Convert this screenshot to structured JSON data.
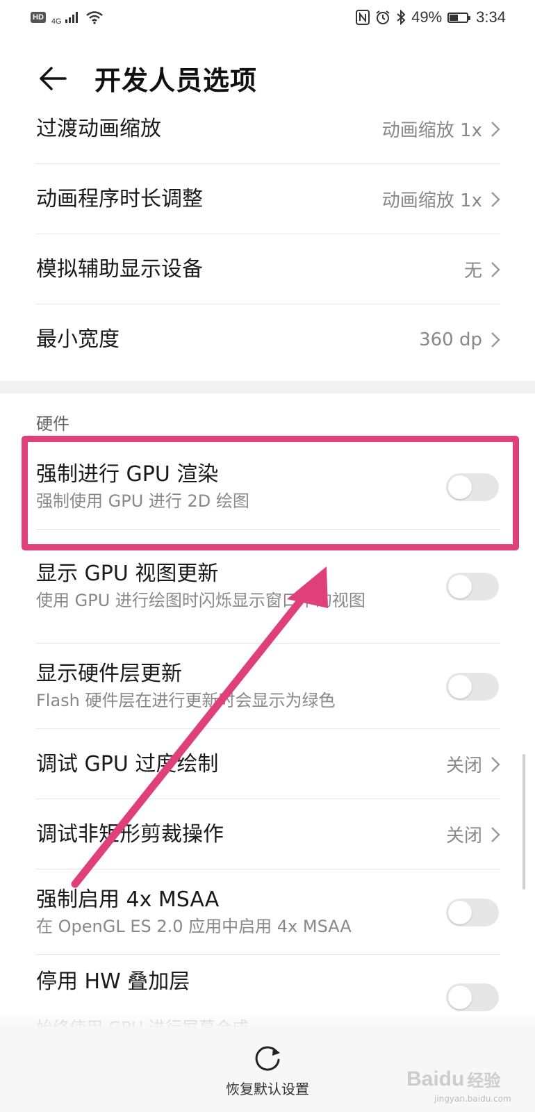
{
  "status_bar": {
    "hd": "HD",
    "network": "4G",
    "battery": "49%",
    "battery_level": 0.49,
    "time": "3:34",
    "icons": [
      "signal-icon",
      "wifi-icon",
      "nfc-icon",
      "alarm-icon",
      "bluetooth-icon",
      "battery-icon"
    ]
  },
  "header": {
    "title": "开发人员选项",
    "back_icon": "back-arrow-icon"
  },
  "items_top": [
    {
      "title": "过渡动画缩放",
      "value": "动画缩放 1x"
    },
    {
      "title": "动画程序时长调整",
      "value": "动画缩放 1x"
    },
    {
      "title": "模拟辅助显示设备",
      "value": "无"
    },
    {
      "title": "最小宽度",
      "value": "360 dp"
    }
  ],
  "hardware": {
    "section_label": "硬件",
    "items": [
      {
        "title": "强制进行 GPU 渲染",
        "subtitle": "强制使用 GPU 进行 2D 绘图",
        "toggle": false
      },
      {
        "title": "显示 GPU 视图更新",
        "subtitle": "使用 GPU 进行绘图时闪烁显示窗口中的视图",
        "toggle": false
      },
      {
        "title": "显示硬件层更新",
        "subtitle": "Flash 硬件层在进行更新时会显示为绿色",
        "toggle": false
      },
      {
        "title": "调试 GPU 过度绘制",
        "value": "关闭"
      },
      {
        "title": "调试非矩形剪裁操作",
        "value": "关闭"
      },
      {
        "title": "强制启用 4x MSAA",
        "subtitle": "在 OpenGL ES 2.0 应用中启用 4x MSAA",
        "toggle": false
      },
      {
        "title": "停用 HW 叠加层",
        "subtitle": "始终使用 GPU 进行屏幕合成",
        "toggle": false
      }
    ]
  },
  "bottom": {
    "restore_label": "恢复默认设置",
    "restore_icon": "refresh-icon"
  },
  "watermark": {
    "brand": "Baidu",
    "brand_suffix": "经验",
    "domain": "jingyan.baidu.com"
  },
  "colors": {
    "highlight": "#e0407a",
    "toggle_off": "#e6e6e6",
    "secondary_text": "#888888"
  }
}
